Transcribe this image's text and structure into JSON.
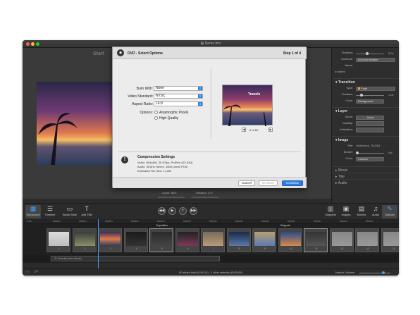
{
  "window": {
    "title": "Demo.fms"
  },
  "canvas": {
    "start_label": "Start"
  },
  "inspector": {
    "duration_label": "Duration:",
    "duration_value": "5,0s",
    "continue_label": "Continue:",
    "continue_value": "At Audio Marker",
    "name_label": "Name:",
    "notes_label": "Notes",
    "transition_title": "Transition",
    "type_label": "Type:",
    "type_value": "Fade",
    "t_duration_label": "Duration:",
    "t_duration_value": "1,0s",
    "color_label": "Color:",
    "color_value": "Background",
    "layer_title": "Layer",
    "move_label": "Move:",
    "move_value": "None",
    "visibility_label": "Visibility:",
    "animation_label": "Animation:",
    "image_title": "Image",
    "file_label": "File:",
    "file_value": "shutterstock_7818304",
    "border_label": "Border:",
    "border_value": "0pt",
    "i_color_label": "Color:",
    "i_color_value": "Custom",
    "collapsed": [
      "Movie",
      "Title",
      "Audio"
    ]
  },
  "dialog": {
    "icon": "DVD",
    "title": "DVD - Select Options",
    "step": "Step 1 of 4",
    "burn_label": "Burn With:",
    "burn_value": "None",
    "standard_label": "Video Standard:",
    "standard_value": "NTSC",
    "aspect_label": "Aspect Ratio:",
    "aspect_value": "16:9",
    "options_label": "Options:",
    "opt1": "Anamorphic Pixels",
    "opt2": "High Quality",
    "preview_title": "Travels",
    "preview_page": "8 of 60",
    "compression_title": "Compression Settings",
    "comp_line1": "Video: 854x480, 29.97fps, ProRes 422 (HQ)",
    "comp_line2": "Audio: 48 kHz Stereo, 16bit Linear PCM",
    "comp_line3": "Estimated File Size: 1,1GB",
    "cancel": "Cancel",
    "go_back": "Go Back",
    "continue": "Continue"
  },
  "zoom": {
    "zoom_label": "Zoom: 88%",
    "rotation_label": "Rotation: 0,0°"
  },
  "toolbar": {
    "storyboard": "Storyboard",
    "timeline": "Timeline",
    "blank_slide": "Blank Slide",
    "add_title": "Add Title",
    "snippets": "Snippets",
    "images": "Images",
    "movies": "Movies",
    "audio": "Audio",
    "options": "Options"
  },
  "ruler": [
    "0,0s",
    "Marker",
    "Marker",
    "Marker",
    "Marker",
    "Marker",
    "Marker",
    "Marker",
    "Marker",
    "Marker",
    "Marker",
    "Marker",
    "Marker",
    "Marker"
  ],
  "timeline": {
    "labels": [
      "Exposition",
      "Snippets"
    ],
    "clip_nums": [
      "1",
      "2",
      "3",
      "4",
      "5",
      "6",
      "7",
      "8",
      "9",
      "10",
      "11",
      "12",
      "13",
      "14",
      "15"
    ],
    "audio_clip": "01 Cherubs (Intro Music)"
  },
  "status": {
    "text": "60 slides total (0:04:14) - 1 slide selected (0:00:05)",
    "master_volume": "Master Volume:"
  },
  "colors": {
    "accent": "#2b7de0",
    "playhead": "#3fa0ff"
  }
}
